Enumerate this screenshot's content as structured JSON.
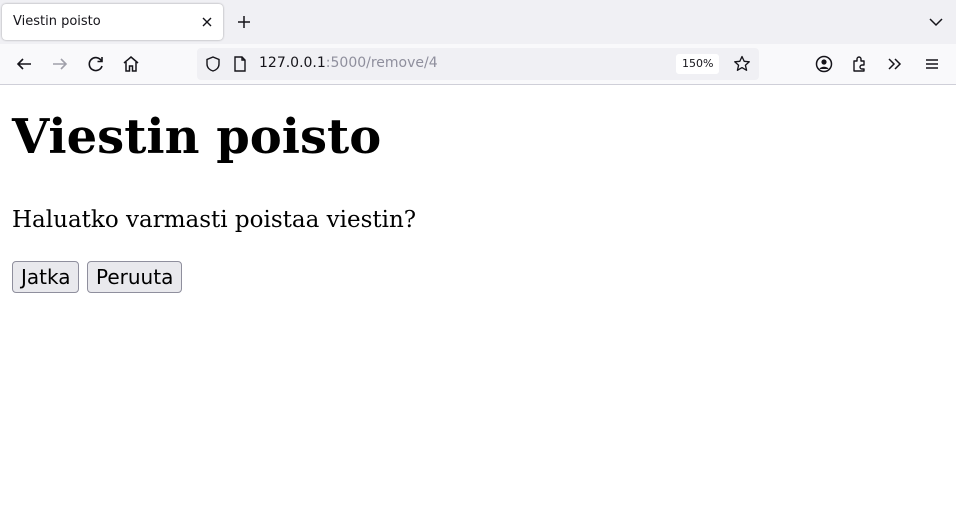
{
  "browser": {
    "tab": {
      "title": "Viestin poisto"
    },
    "address": {
      "host": "127.0.0.1",
      "path": ":5000/remove/4"
    },
    "zoom": "150%"
  },
  "page": {
    "title": "Viestin poisto",
    "question": "Haluatko varmasti poistaa viestin?",
    "buttons": {
      "confirm": "Jatka",
      "cancel": "Peruuta"
    }
  }
}
